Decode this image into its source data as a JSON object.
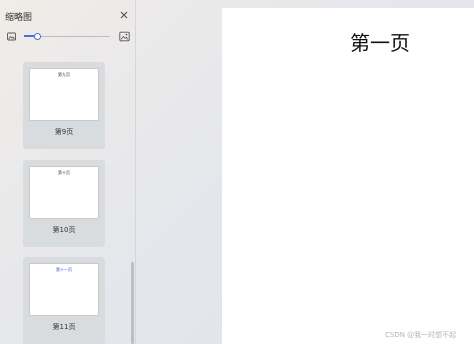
{
  "panel": {
    "title": "缩略图",
    "close_icon": "close-icon",
    "zoom": {
      "level": 0.15,
      "small_icon": "image-small-icon",
      "large_icon": "image-large-icon",
      "accent": "#4a70d8"
    }
  },
  "thumbnails": [
    {
      "heading": "第九页",
      "label": "第9页",
      "heading_color": "#333333"
    },
    {
      "heading": "第十页",
      "label": "第10页",
      "heading_color": "#333333"
    },
    {
      "heading": "第十一页",
      "label": "第11页",
      "heading_color": "#2a4bd8"
    }
  ],
  "page": {
    "heading": "第一页"
  },
  "watermark": "CSDN @我一时想不起"
}
